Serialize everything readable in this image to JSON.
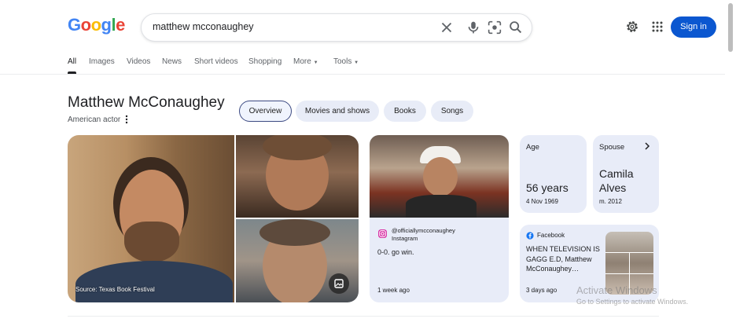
{
  "logo": {
    "letters": [
      "G",
      "o",
      "o",
      "g",
      "l",
      "e"
    ]
  },
  "search": {
    "query": "matthew mcconaughey"
  },
  "header": {
    "signin_label": "Sign in"
  },
  "tabs": [
    {
      "label": "All",
      "active": true
    },
    {
      "label": "Images"
    },
    {
      "label": "Videos"
    },
    {
      "label": "News"
    },
    {
      "label": "Short videos"
    },
    {
      "label": "Shopping"
    },
    {
      "label": "More"
    },
    {
      "label": "Tools"
    }
  ],
  "entity": {
    "name": "Matthew McConaughey",
    "subtitle": "American actor",
    "chips": [
      "Overview",
      "Movies and shows",
      "Books",
      "Songs"
    ]
  },
  "images": {
    "source": "Source: Texas Book Festival"
  },
  "instagram": {
    "handle": "@officiallymcconaughey",
    "source": "Instagram",
    "text": "0-0. go win.",
    "time": "1 week ago"
  },
  "facts": {
    "age": {
      "label": "Age",
      "value": "56 years",
      "sub": "4 Nov 1969"
    },
    "spouse": {
      "label": "Spouse",
      "value_line1": "Camila",
      "value_line2": "Alves",
      "sub": "m. 2012"
    }
  },
  "facebook": {
    "source": "Facebook",
    "text": "WHEN TELEVISION IS GAGG E.D, Matthew McConaughey…",
    "time": "3 days ago"
  },
  "watermark": {
    "line1": "Activate Windows",
    "line2": "Go to Settings to activate Windows."
  },
  "colors": {
    "accent": "#0b57d0",
    "chip_bg": "#e8ecf7",
    "card_bg": "#e8ecf8"
  }
}
